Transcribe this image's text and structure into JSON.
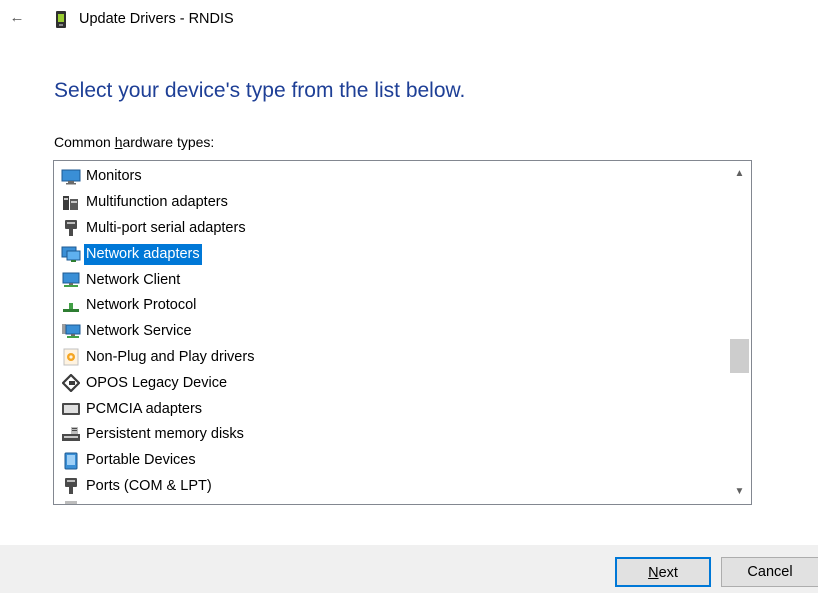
{
  "window": {
    "title": "Update Drivers - RNDIS",
    "back_icon": "arrow-left-icon",
    "title_icon": "driver-device-icon"
  },
  "heading": "Select your device's type from the list below.",
  "list_label": {
    "before": "Common ",
    "mnemonic": "h",
    "after": "ardware types:"
  },
  "hardware_types": {
    "selected": "Network adapters",
    "items": [
      {
        "label": "Monitors",
        "icon": "monitor-icon"
      },
      {
        "label": "Multifunction adapters",
        "icon": "multifunction-adapter-icon"
      },
      {
        "label": "Multi-port serial adapters",
        "icon": "serial-port-icon"
      },
      {
        "label": "Network adapters",
        "icon": "network-adapter-icon"
      },
      {
        "label": "Network Client",
        "icon": "network-client-icon"
      },
      {
        "label": "Network Protocol",
        "icon": "network-protocol-icon"
      },
      {
        "label": "Network Service",
        "icon": "network-service-icon"
      },
      {
        "label": "Non-Plug and Play drivers",
        "icon": "non-pnp-driver-icon"
      },
      {
        "label": "OPOS Legacy Device",
        "icon": "opos-device-icon"
      },
      {
        "label": "PCMCIA adapters",
        "icon": "pcmcia-adapter-icon"
      },
      {
        "label": "Persistent memory disks",
        "icon": "memory-disk-icon"
      },
      {
        "label": "Portable Devices",
        "icon": "portable-device-icon"
      },
      {
        "label": "Ports (COM & LPT)",
        "icon": "port-icon"
      }
    ]
  },
  "buttons": {
    "next": {
      "mnemonic": "N",
      "rest": "ext"
    },
    "cancel": "Cancel"
  },
  "colors": {
    "heading": "#1e3f96",
    "selection": "#0078d7",
    "footer_bg": "#f0f0f0"
  }
}
